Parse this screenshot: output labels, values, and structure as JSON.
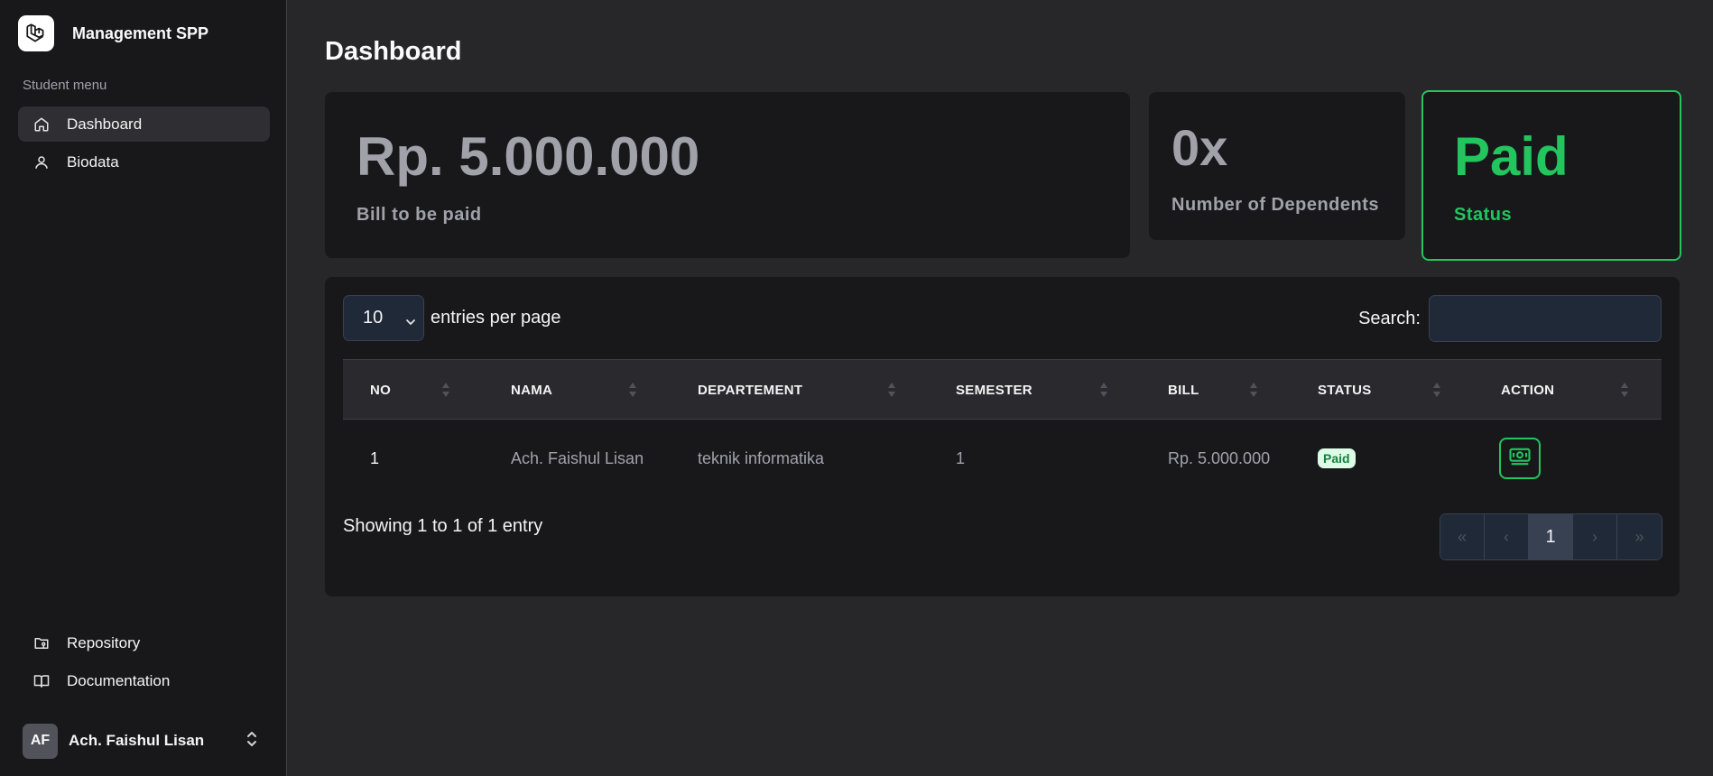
{
  "sidebar": {
    "brand": "Management SPP",
    "menu_heading": "Student menu",
    "items": [
      {
        "label": "Dashboard",
        "icon": "home-icon",
        "active": true
      },
      {
        "label": "Biodata",
        "icon": "user-icon",
        "active": false
      }
    ],
    "bottom_items": [
      {
        "label": "Repository",
        "icon": "folder-git-icon"
      },
      {
        "label": "Documentation",
        "icon": "book-icon"
      }
    ],
    "user": {
      "initials": "AF",
      "name": "Ach. Faishul Lisan"
    }
  },
  "page": {
    "title": "Dashboard"
  },
  "cards": {
    "bill": {
      "value": "Rp. 5.000.000",
      "label": "Bill to be paid"
    },
    "dependents": {
      "value": "0x",
      "label": "Number of Dependents"
    },
    "status": {
      "value": "Paid",
      "label": "Status",
      "color": "#22c55e"
    }
  },
  "table": {
    "entries_value": "10",
    "entries_label": "entries per page",
    "search_label": "Search:",
    "search_value": "",
    "columns": [
      "NO",
      "NAMA",
      "DEPARTEMENT",
      "SEMESTER",
      "BILL",
      "STATUS",
      "ACTION"
    ],
    "rows": [
      {
        "no": "1",
        "nama": "Ach. Faishul Lisan",
        "departement": "teknik informatika",
        "semester": "1",
        "bill": "Rp. 5.000.000",
        "status": "Paid",
        "action_icon": "banknote-icon"
      }
    ],
    "showing": "Showing 1 to 1 of 1 entry",
    "pagination": [
      "«",
      "‹",
      "1",
      "›",
      "»"
    ],
    "current_page": "1"
  },
  "colors": {
    "accent": "#22c55e",
    "sidebar_bg": "#18181b",
    "page_bg": "#27272a"
  }
}
